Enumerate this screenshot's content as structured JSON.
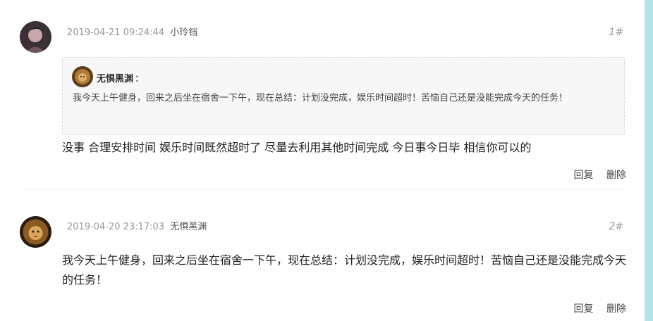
{
  "comments": [
    {
      "time": "2019-04-21 09:24:44",
      "user": "小玲铛",
      "floor": "1#",
      "quote": {
        "user": "无惧黑渊",
        "colon": "：",
        "text": "我今天上午健身，回来之后坐在宿舍一下午，现在总结：计划没完成，娱乐时间超时！苦恼自己还是没能完成今天的任务！"
      },
      "text": "没事 合理安排时间 娱乐时间既然超时了 尽量去利用其他时间完成 今日事今日毕 相信你可以的",
      "reply_label": "回复",
      "delete_label": "删除"
    },
    {
      "time": "2019-04-20 23:17:03",
      "user": "无惧黑渊",
      "floor": "2#",
      "text": "我今天上午健身，回来之后坐在宿舍一下午，现在总结：计划没完成，娱乐时间超时！苦恼自己还是没能完成今天的任务！",
      "reply_label": "回复",
      "delete_label": "删除"
    }
  ],
  "colors": {
    "page_background": "#b5e3e6",
    "panel_background": "#ffffff",
    "quote_background": "#f7f7f7",
    "muted_text": "#999999"
  }
}
